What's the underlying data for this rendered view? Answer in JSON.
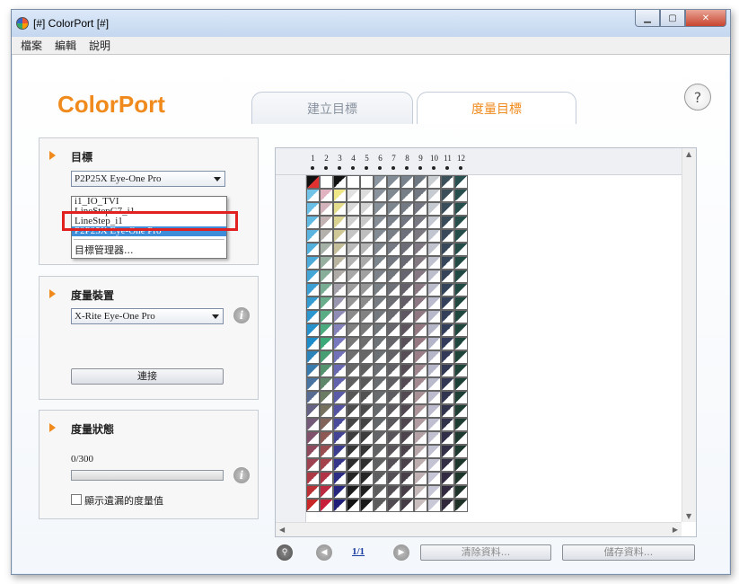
{
  "window": {
    "title": "[#] ColorPort [#]",
    "min_label": "▁",
    "max_label": "▢",
    "close_label": "✕"
  },
  "menu": [
    "檔案",
    "編輯",
    "說明"
  ],
  "brand": "ColorPort",
  "tabs": [
    {
      "label": "建立目標",
      "active": false
    },
    {
      "label": "度量目標",
      "active": true
    }
  ],
  "help_label": "?",
  "target_panel": {
    "title": "目標",
    "selected": "P2P25X Eye-One Pro",
    "options": [
      "i1_IO_TVI",
      "LineStepG7_i1",
      "LineStep_i1",
      "P2P25X Eye-One Pro"
    ],
    "manage": "目標管理器..."
  },
  "device_panel": {
    "title": "度量裝置",
    "selected": "X-Rite Eye-One Pro",
    "connect": "連接",
    "info": "i"
  },
  "status_panel": {
    "title": "度量狀態",
    "count": "0/300",
    "progress": 0,
    "show_missing": "顯示遺漏的度量值",
    "info": "i"
  },
  "grid": {
    "columns": [
      "1",
      "2",
      "3",
      "4",
      "5",
      "6",
      "7",
      "8",
      "9",
      "10",
      "11",
      "12"
    ],
    "rows": 25
  },
  "bottom": {
    "zoom_icon": "⚲",
    "prev_icon": "◀",
    "page": "1/1",
    "next_icon": "▶",
    "clear": "清除資料...",
    "save": "儲存資料..."
  },
  "colors": {
    "accent": "#f08a1c",
    "highlight": "#e12020",
    "selection": "#3f8cd8"
  }
}
